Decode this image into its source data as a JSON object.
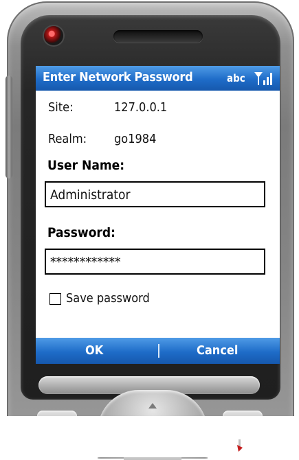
{
  "dialog": {
    "title": "Enter Network Password",
    "input_mode": "abc",
    "site": {
      "label": "Site:",
      "value": "127.0.0.1"
    },
    "realm": {
      "label": "Realm:",
      "value": "go1984"
    },
    "user_name": {
      "label": "User Name:",
      "value": "Administrator"
    },
    "password": {
      "label": "Password:",
      "value": "************"
    },
    "save_password": {
      "label": "Save password",
      "checked": false
    }
  },
  "softkeys": {
    "left": "OK",
    "right": "Cancel"
  },
  "colors": {
    "bar_blue": "#1e6cc8",
    "screen_bg": "#ffffff",
    "phone_gray": "#7b7b7b"
  },
  "icons": [
    "signal-strength-icon",
    "home-icon",
    "back-icon",
    "up-arrow-icon"
  ]
}
